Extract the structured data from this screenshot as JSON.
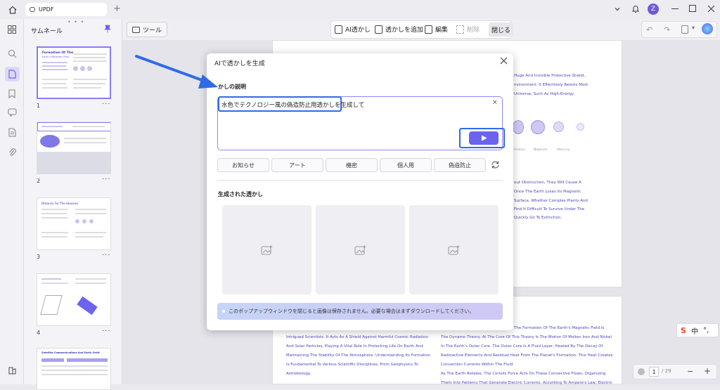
{
  "app": {
    "tab_title": "UPDF",
    "avatar_letter": "Z"
  },
  "sidebar_header": {
    "title": "サムネール"
  },
  "thumbnails": [
    {
      "page": "1",
      "title": "Formation Of The",
      "subtitle": "Earth's Magnetic Field"
    },
    {
      "page": "2"
    },
    {
      "page": "3",
      "title": "Distance For The Heavens"
    },
    {
      "page": "4"
    },
    {
      "page": "",
      "title": "Satellite Communications And Earth Orbit"
    }
  ],
  "toolbar": {
    "tools_label": "ツール",
    "ai_watermark_label": "AI透かし",
    "add_watermark_label": "透かしを追加",
    "edit_label": "編集",
    "delete_label": "削除",
    "close_label": "閉じる"
  },
  "document": {
    "page1_right_lines": [
      "Huge And Invisible Protective Shield,",
      "nvironment. It Effectively Resists Most",
      "Universe, Such As High-Energy"
    ],
    "planet_labels": [
      "Uranus",
      "Neptune",
      "Mercury"
    ],
    "page1_lower_lines": [
      "out Obstruction, They Will Cause A",
      "Once The Earth Loses Its Magnetic",
      "Surface, Whether Complex Plants And",
      "Find It Difficult To Survive Under The",
      "Quickly Go To Extinction."
    ],
    "page2_left_lines": [
      "Intrigued Scientists. It Acts As A Shield Against Harmful Cosmic Radiation",
      "And Solar Particles, Playing A Vital Role In Protecting Life On Earth And",
      "Maintaining The Stability Of The Atmosphere. Understanding Its Formation",
      "Is Fundamental To Various Scientific Disciplines, From Geophysics To",
      "Astrobiology."
    ],
    "page2_right_lines": [
      "The Formation Of The Earth's Magnetic Field Is",
      "The Dynamo Theory. At The Core Of This Theory Is The Motion Of Molten Iron And Nickel",
      "In The Earth's Outer Core. The Outer Core Is A Fluid Layer, Heated By The Decay Of",
      "Radioactive Elements And Residual Heat From The Planet's Formation. This Heat Creates",
      "Convection Currents Within The Fluid.",
      "As The Earth Rotates, The Coriolis Force Acts On These Convective Flows, Organizing",
      "Them Into Patterns That Generate Electric Currents. According To Ampere's Law, Electric"
    ]
  },
  "dialog": {
    "title": "AIで透かしを生成",
    "description_label": "かしの説明",
    "prompt_value": "水色でテクノロジー風の偽造防止用透かしを生成して",
    "presets": [
      "お知らせ",
      "アート",
      "機密",
      "個人用",
      "偽造防止"
    ],
    "generated_label": "生成された透かし",
    "notice": "このポップアップウィンドウを閉じると画像は保存されません。必要な場合はまずダウンロードしてください。"
  },
  "pagination": {
    "current": "1",
    "total": "/ 29"
  },
  "ime": {
    "label": "中"
  },
  "colors": {
    "accent": "#6c63f0",
    "highlight": "#2f6be6",
    "arrow": "#2f6be6",
    "notice_bg": "#c9ccf5"
  }
}
